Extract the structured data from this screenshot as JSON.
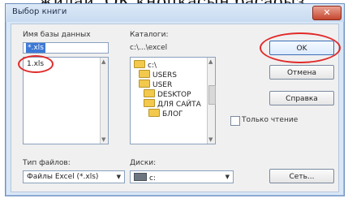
{
  "caption": "жидаи, ОК кнопкасын басаоыз.",
  "dialog": {
    "title": "Выбор книги",
    "close_glyph": "✕"
  },
  "db_name": {
    "label": "Имя базы данных",
    "value": "*.xls",
    "files": [
      "1.xls"
    ]
  },
  "catalogs": {
    "label": "Каталоги:",
    "path": "c:\\...\\excel",
    "tree": [
      {
        "name": "c:\\",
        "level": 0
      },
      {
        "name": "USERS",
        "level": 1
      },
      {
        "name": "USER",
        "level": 1
      },
      {
        "name": "DESKTOP",
        "level": 2
      },
      {
        "name": "ДЛЯ САЙТА",
        "level": 2
      },
      {
        "name": "БЛОГ",
        "level": 3
      }
    ]
  },
  "buttons": {
    "ok": "OK",
    "cancel": "Отмена",
    "help": "Справка",
    "network": "Сеть..."
  },
  "readonly_label": "Только чтение",
  "filetype": {
    "label": "Тип файлов:",
    "value": "Файлы Excel (*.xls)"
  },
  "drives": {
    "label": "Диски:",
    "value": "c:"
  },
  "highlight_color": "#e12a2a"
}
